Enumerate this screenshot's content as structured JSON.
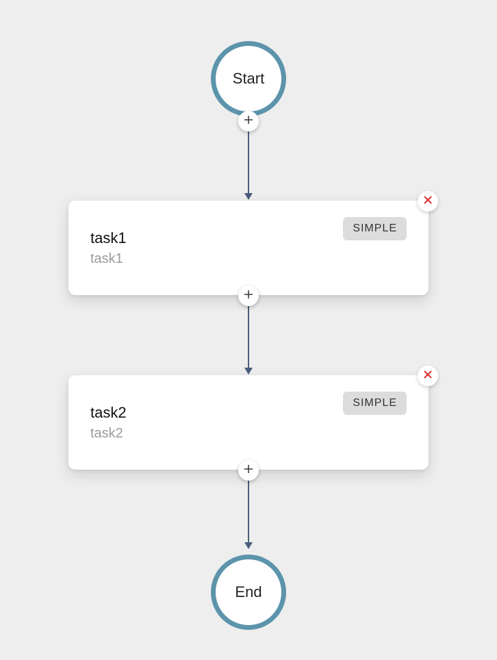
{
  "nodes": {
    "start": {
      "label": "Start"
    },
    "end": {
      "label": "End"
    }
  },
  "tasks": [
    {
      "title": "task1",
      "subtitle": "task1",
      "badge": "SIMPLE"
    },
    {
      "title": "task2",
      "subtitle": "task2",
      "badge": "SIMPLE"
    }
  ]
}
